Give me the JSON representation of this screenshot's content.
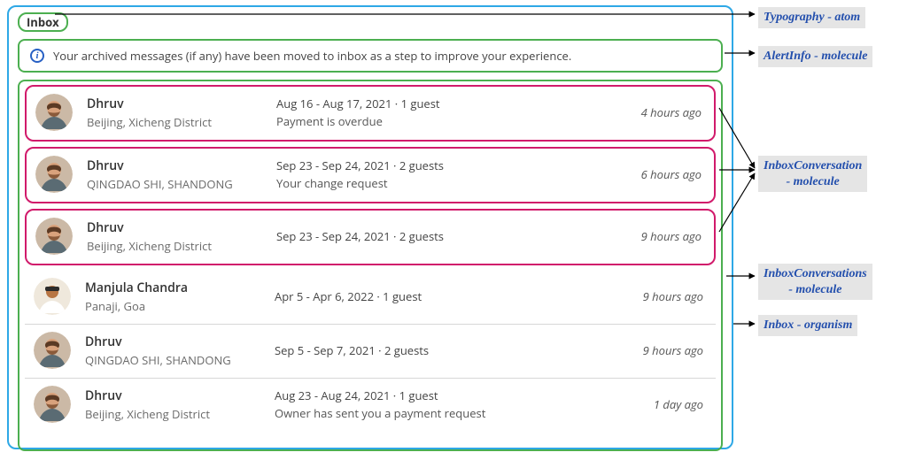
{
  "header": {
    "title": "Inbox"
  },
  "alert": {
    "icon": "info-icon",
    "text": "Your archived messages (if any) have been moved to inbox as a step to improve your experience."
  },
  "conversations": [
    {
      "name": "Dhruv",
      "place": "Beijing, Xicheng District",
      "dates": "Aug 16 - Aug 17, 2021",
      "guests": "1 guest",
      "subject": "Payment is overdue",
      "ago": "4 hours ago",
      "highlight": true,
      "avatar": "man1"
    },
    {
      "name": "Dhruv",
      "place": "QINGDAO SHI, SHANDONG",
      "dates": "Sep 23 - Sep 24, 2021",
      "guests": "2 guests",
      "subject": "Your change request",
      "ago": "6 hours ago",
      "highlight": true,
      "avatar": "man1"
    },
    {
      "name": "Dhruv",
      "place": "Beijing, Xicheng District",
      "dates": "Sep 23 - Sep 24, 2021",
      "guests": "2 guests",
      "subject": "",
      "ago": "9 hours ago",
      "highlight": true,
      "avatar": "man1"
    },
    {
      "name": "Manjula Chandra",
      "place": "Panaji, Goa",
      "dates": "Apr 5 - Apr 6, 2022",
      "guests": "1 guest",
      "subject": "",
      "ago": "9 hours ago",
      "highlight": false,
      "avatar": "man2"
    },
    {
      "name": "Dhruv",
      "place": "QINGDAO SHI, SHANDONG",
      "dates": "Sep 5 - Sep 7, 2021",
      "guests": "2 guests",
      "subject": "",
      "ago": "9 hours ago",
      "highlight": false,
      "avatar": "man1"
    },
    {
      "name": "Dhruv",
      "place": "Beijing, Xicheng District",
      "dates": "Aug 23 - Aug 24, 2021",
      "guests": "1 guest",
      "subject": "Owner has sent you a payment request",
      "ago": "1 day ago",
      "highlight": false,
      "avatar": "man1"
    }
  ],
  "annotations": {
    "typography": "Typography - atom",
    "alertinfo": "AlertInfo - molecule",
    "inboxconv": "InboxConversation\n- molecule",
    "inboxconvs": "InboxConversations\n- molecule",
    "inboxorg": "Inbox - organism"
  },
  "colors": {
    "organism_border": "#2ea8e6",
    "molecule_border": "#4caf50",
    "highlight_border": "#d11a6b",
    "annotation_text": "#234fad",
    "annotation_bg": "#e5e5e5"
  },
  "meta_separator": "  ·  "
}
